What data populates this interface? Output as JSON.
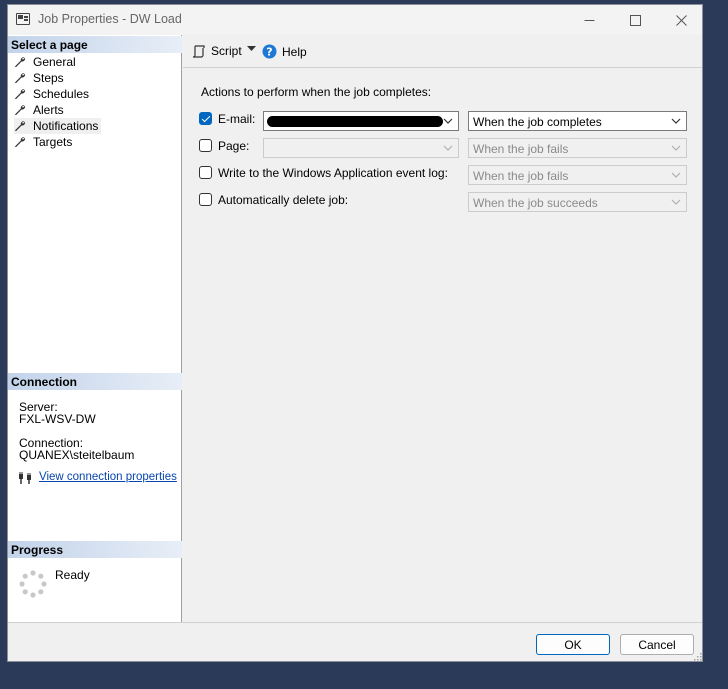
{
  "window": {
    "title": "Job Properties - DW Load"
  },
  "left_pane": {
    "select_page_header": "Select a page",
    "items": [
      {
        "label": "General"
      },
      {
        "label": "Steps"
      },
      {
        "label": "Schedules"
      },
      {
        "label": "Alerts"
      },
      {
        "label": "Notifications"
      },
      {
        "label": "Targets"
      }
    ],
    "selected": "Notifications",
    "connection_header": "Connection",
    "server_label": "Server:",
    "server_value": "FXL-WSV-DW",
    "connection_label": "Connection:",
    "connection_value": "QUANEX\\steitelbaum",
    "view_connection_link": "View connection properties",
    "progress_header": "Progress",
    "progress_status": "Ready"
  },
  "toolbar": {
    "script_label": "Script",
    "help_label": "Help"
  },
  "main": {
    "heading": "Actions to perform when the job completes:",
    "rows": [
      {
        "label": "E-mail:",
        "checked": true,
        "operator_value": "",
        "condition": "When the job completes",
        "enabled": true
      },
      {
        "label": "Page:",
        "checked": false,
        "operator_value": "",
        "condition": "When the job fails",
        "enabled": false
      },
      {
        "label": "Write to the Windows Application event log:",
        "checked": false,
        "condition": "When the job fails",
        "enabled": false
      },
      {
        "label": "Automatically delete job:",
        "checked": false,
        "condition": "When the job succeeds",
        "enabled": false
      }
    ]
  },
  "buttons": {
    "ok_label": "OK",
    "cancel_label": "Cancel"
  },
  "colors": {
    "accent": "#0067c0",
    "link": "#0645ad",
    "header_gradient_start": "#c2d3ea"
  }
}
